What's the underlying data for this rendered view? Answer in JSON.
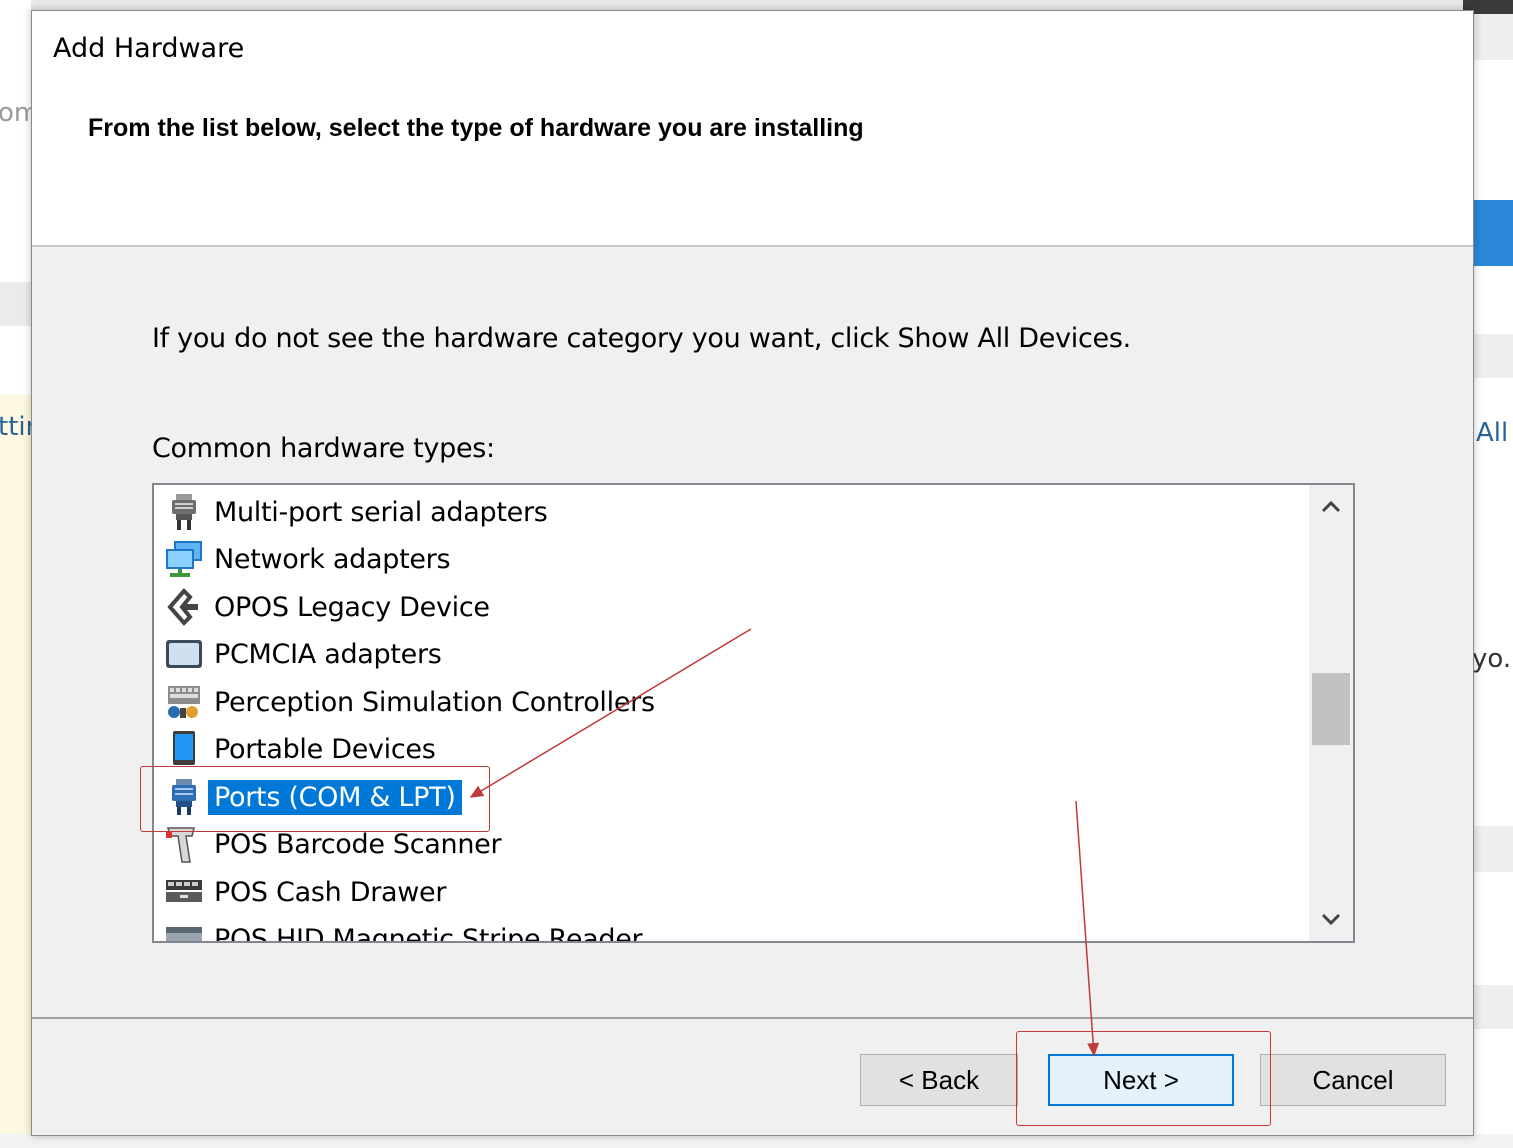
{
  "background": {
    "frag_om": "om",
    "frag_ttin": "ttin",
    "frag_all": "All",
    "frag_yo": "yo."
  },
  "dialog": {
    "title": "Add Hardware",
    "heading": "From the list below, select the type of hardware you are installing",
    "instruction": "If you do not see the hardware category you want, click Show All Devices.",
    "list_label": "Common hardware types:",
    "items": [
      {
        "label": "Multi-port serial adapters",
        "icon": "serial-port-icon",
        "selected": false
      },
      {
        "label": "Network adapters",
        "icon": "network-adapter-icon",
        "selected": false
      },
      {
        "label": "OPOS Legacy Device",
        "icon": "opos-device-icon",
        "selected": false
      },
      {
        "label": "PCMCIA adapters",
        "icon": "pcmcia-icon",
        "selected": false
      },
      {
        "label": "Perception Simulation Controllers",
        "icon": "perception-controller-icon",
        "selected": false
      },
      {
        "label": "Portable Devices",
        "icon": "portable-device-icon",
        "selected": false
      },
      {
        "label": "Ports (COM & LPT)",
        "icon": "port-icon",
        "selected": true
      },
      {
        "label": "POS Barcode Scanner",
        "icon": "barcode-scanner-icon",
        "selected": false
      },
      {
        "label": "POS Cash Drawer",
        "icon": "cash-drawer-icon",
        "selected": false
      },
      {
        "label": "POS HID Magnetic Stripe Reader",
        "icon": "stripe-reader-icon",
        "selected": false
      }
    ],
    "buttons": {
      "back": "< Back",
      "next": "Next >",
      "cancel": "Cancel"
    }
  },
  "colors": {
    "selection": "#0078d7",
    "annotation": "#c0393b"
  }
}
